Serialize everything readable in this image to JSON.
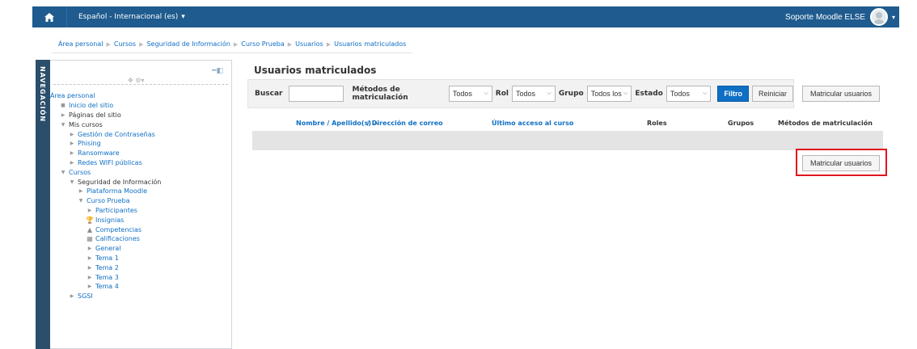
{
  "navbar": {
    "language": "Español - Internacional (es)",
    "user_name": "Soporte Moodle ELSE"
  },
  "breadcrumb": [
    "Área personal",
    "Cursos",
    "Seguridad de Información",
    "Curso Prueba",
    "Usuarios",
    "Usuarios matriculados"
  ],
  "nav_block": {
    "tab_label": "NAVEGACIÓN",
    "items": [
      {
        "label": "Área personal",
        "level": 0,
        "icon": "none",
        "style": "link"
      },
      {
        "label": "Inicio del sitio",
        "level": 1,
        "icon": "bullet",
        "style": "link"
      },
      {
        "label": "Páginas del sitio",
        "level": 1,
        "icon": "collapsed",
        "style": "dark"
      },
      {
        "label": "Mis cursos",
        "level": 1,
        "icon": "expanded",
        "style": "dark"
      },
      {
        "label": "Gestión de Contraseñas",
        "level": 2,
        "icon": "collapsed",
        "style": "link"
      },
      {
        "label": "Phising",
        "level": 2,
        "icon": "collapsed",
        "style": "link"
      },
      {
        "label": "Ransomware",
        "level": 2,
        "icon": "collapsed",
        "style": "link"
      },
      {
        "label": "Redes WIFI públicas",
        "level": 2,
        "icon": "collapsed",
        "style": "link"
      },
      {
        "label": "Cursos",
        "level": 1,
        "icon": "expanded",
        "style": "link"
      },
      {
        "label": "Seguridad de Información",
        "level": 2,
        "icon": "expanded",
        "style": "dark"
      },
      {
        "label": "Plataforma Moodle",
        "level": 3,
        "icon": "collapsed",
        "style": "link"
      },
      {
        "label": "Curso Prueba",
        "level": 3,
        "icon": "expanded",
        "style": "link"
      },
      {
        "label": "Participantes",
        "level": 4,
        "icon": "collapsed",
        "style": "link"
      },
      {
        "label": "Insignias",
        "level": 4,
        "icon": "trophy",
        "style": "link"
      },
      {
        "label": "Competencias",
        "level": 4,
        "icon": "competency",
        "style": "link"
      },
      {
        "label": "Calificaciones",
        "level": 4,
        "icon": "grades",
        "style": "link"
      },
      {
        "label": "General",
        "level": 4,
        "icon": "collapsed",
        "style": "link"
      },
      {
        "label": "Tema 1",
        "level": 4,
        "icon": "collapsed",
        "style": "link"
      },
      {
        "label": "Tema 2",
        "level": 4,
        "icon": "collapsed",
        "style": "link"
      },
      {
        "label": "Tema 3",
        "level": 4,
        "icon": "collapsed",
        "style": "link"
      },
      {
        "label": "Tema 4",
        "level": 4,
        "icon": "collapsed",
        "style": "link"
      },
      {
        "label": "SGSI",
        "level": 2,
        "icon": "collapsed",
        "style": "link"
      }
    ]
  },
  "main": {
    "title": "Usuarios matriculados",
    "filters": {
      "search_label": "Buscar",
      "search_value": "",
      "methods_label": "Métodos de matriculación",
      "methods_value": "Todos",
      "role_label": "Rol",
      "role_value": "Todos",
      "group_label": "Grupo",
      "group_value": "Todos los",
      "status_label": "Estado",
      "status_value": "Todos",
      "filter_button": "Filtro",
      "reset_button": "Reiniciar"
    },
    "enrol_button": "Matricular usuarios",
    "table": {
      "col_name": "Nombre / Apellido(s)",
      "col_email": "/ Dirección de correo",
      "col_last_access": "Último acceso al curso",
      "col_roles": "Roles",
      "col_groups": "Grupos",
      "col_methods": "Métodos de matriculación"
    }
  },
  "colors": {
    "navbar": "#1f5b8e",
    "link": "#0f6fc5",
    "nav_tab": "#2b4e6b",
    "highlight": "#e0161c"
  }
}
